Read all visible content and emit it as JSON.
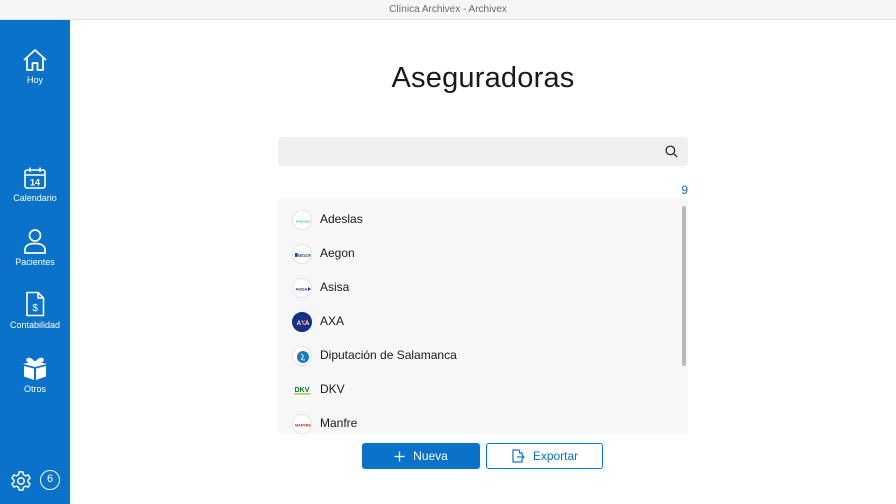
{
  "window": {
    "title": "Clínica Archivex - Archivex"
  },
  "sidebar": {
    "items": [
      {
        "label": "Hoy",
        "icon": "home-icon"
      },
      {
        "label": "Calendario",
        "icon": "calendar-icon",
        "day": "14"
      },
      {
        "label": "Pacientes",
        "icon": "person-icon"
      },
      {
        "label": "Contabilidad",
        "icon": "document-dollar-icon"
      },
      {
        "label": "Otros",
        "icon": "gift-box-icon"
      }
    ],
    "settings_icon": "gear-icon",
    "badge_count": "6"
  },
  "page": {
    "title": "Aseguradoras"
  },
  "search": {
    "value": "",
    "placeholder": "",
    "icon": "search-icon"
  },
  "results": {
    "count": "9"
  },
  "insurers": [
    {
      "name": "Adeslas",
      "logo_text": "Adeslas"
    },
    {
      "name": "Aegon",
      "logo_text": "AEGON"
    },
    {
      "name": "Asisa",
      "logo_text": "ASISA"
    },
    {
      "name": "AXA",
      "logo_text": "AXA"
    },
    {
      "name": "Diputación de Salamanca",
      "logo_text": ""
    },
    {
      "name": "DKV",
      "logo_text": "DKV"
    },
    {
      "name": "Manfre",
      "logo_text": "MAPFRE"
    }
  ],
  "actions": {
    "new_label": "Nueva",
    "export_label": "Exportar"
  },
  "colors": {
    "accent": "#0a73c9",
    "sidebar": "#0a73c9"
  }
}
